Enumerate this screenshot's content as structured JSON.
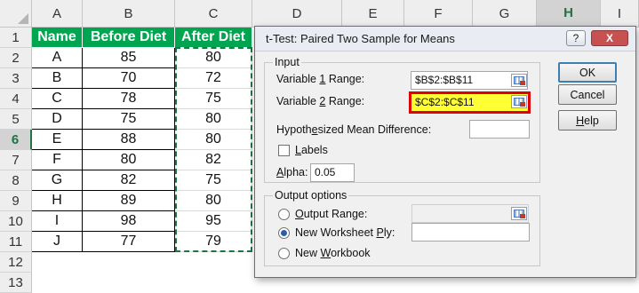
{
  "spreadsheet": {
    "columns": [
      "A",
      "B",
      "C",
      "D",
      "E",
      "F",
      "G",
      "H",
      "I"
    ],
    "active_column": "H",
    "rows": [
      "1",
      "2",
      "3",
      "4",
      "5",
      "6",
      "7",
      "8",
      "9",
      "10",
      "11",
      "12",
      "13"
    ],
    "active_row": "6",
    "table_headers": [
      "Name",
      "Before Diet",
      "After Diet"
    ],
    "table_rows": [
      [
        "A",
        "85",
        "80"
      ],
      [
        "B",
        "70",
        "72"
      ],
      [
        "C",
        "78",
        "75"
      ],
      [
        "D",
        "75",
        "80"
      ],
      [
        "E",
        "88",
        "80"
      ],
      [
        "F",
        "80",
        "82"
      ],
      [
        "G",
        "82",
        "75"
      ],
      [
        "H",
        "89",
        "80"
      ],
      [
        "I",
        "98",
        "95"
      ],
      [
        "J",
        "77",
        "79"
      ]
    ],
    "header_color": "#00a550"
  },
  "dialog": {
    "title": "t-Test: Paired Two Sample for Means",
    "help_glyph": "?",
    "close_glyph": "X",
    "input_group_label": "Input",
    "variable1_label_pre": "Variable ",
    "variable1_label_key": "1",
    "variable1_label_post": " Range:",
    "variable1_value": "$B$2:$B$11",
    "variable2_label_pre": "Variable ",
    "variable2_label_key": "2",
    "variable2_label_post": " Range:",
    "variable2_value": "$C$2:$C$11",
    "hyp_label_pre": "Hypoth",
    "hyp_label_key": "e",
    "hyp_label_post": "sized Mean Difference:",
    "hyp_value": "",
    "labels_key": "L",
    "labels_rest": "abels",
    "alpha_key": "A",
    "alpha_rest": "lpha:",
    "alpha_value": "0.05",
    "output_group_label": "Output options",
    "output_range_key": "O",
    "output_range_rest": "utput Range:",
    "new_ws_pre": "New Worksheet ",
    "new_ws_key": "P",
    "new_ws_post": "ly:",
    "new_wb_pre": "New ",
    "new_wb_key": "W",
    "new_wb_post": "orkbook",
    "ok_label": "OK",
    "cancel_label": "Cancel",
    "help_key": "H",
    "help_rest": "elp",
    "highlight_color": "#ffff33",
    "highlight_border": "#e00000"
  }
}
